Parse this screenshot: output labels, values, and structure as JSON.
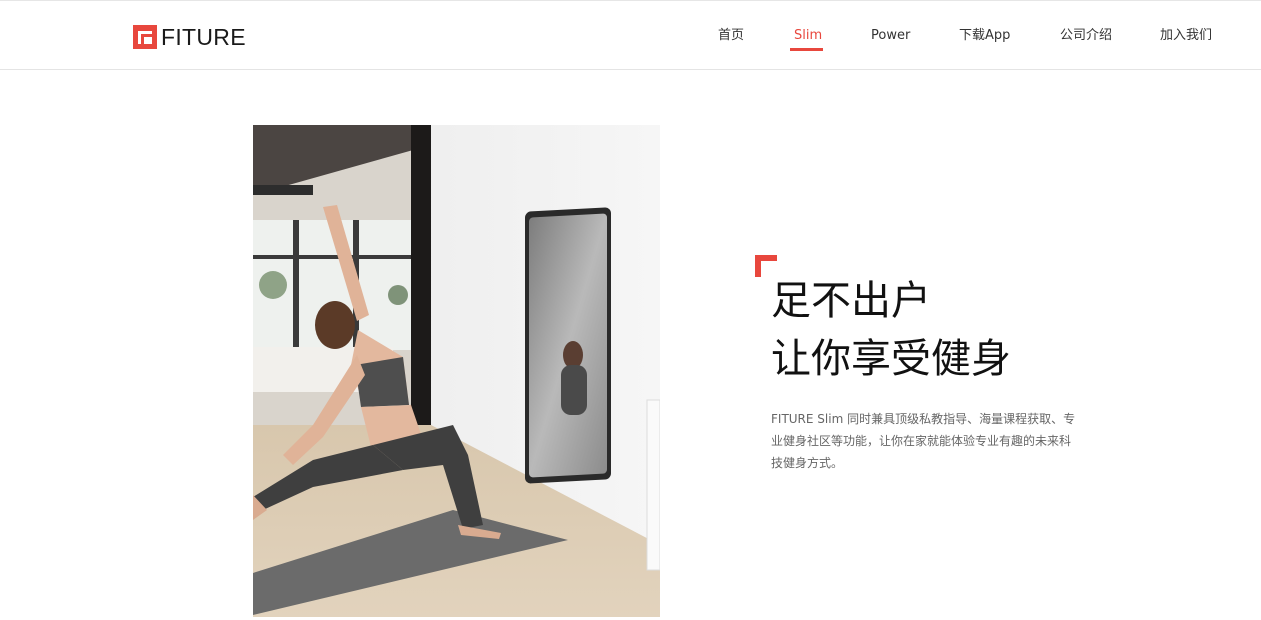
{
  "brand": {
    "name": "FITURE",
    "accent_color": "#e8473d"
  },
  "nav": {
    "items": [
      {
        "label": "首页"
      },
      {
        "label": "Slim",
        "active": true
      },
      {
        "label": "Power"
      },
      {
        "label": "下载App"
      },
      {
        "label": "公司介绍"
      },
      {
        "label": "加入我们"
      }
    ]
  },
  "hero": {
    "image_icon": "yoga-mirror-photo",
    "headline_line1": "足不出户",
    "headline_line2": "让你享受健身",
    "description": "FITURE Slim 同时兼具顶级私教指导、海量课程获取、专业健身社区等功能，让你在家就能体验专业有趣的未来科技健身方式。"
  }
}
